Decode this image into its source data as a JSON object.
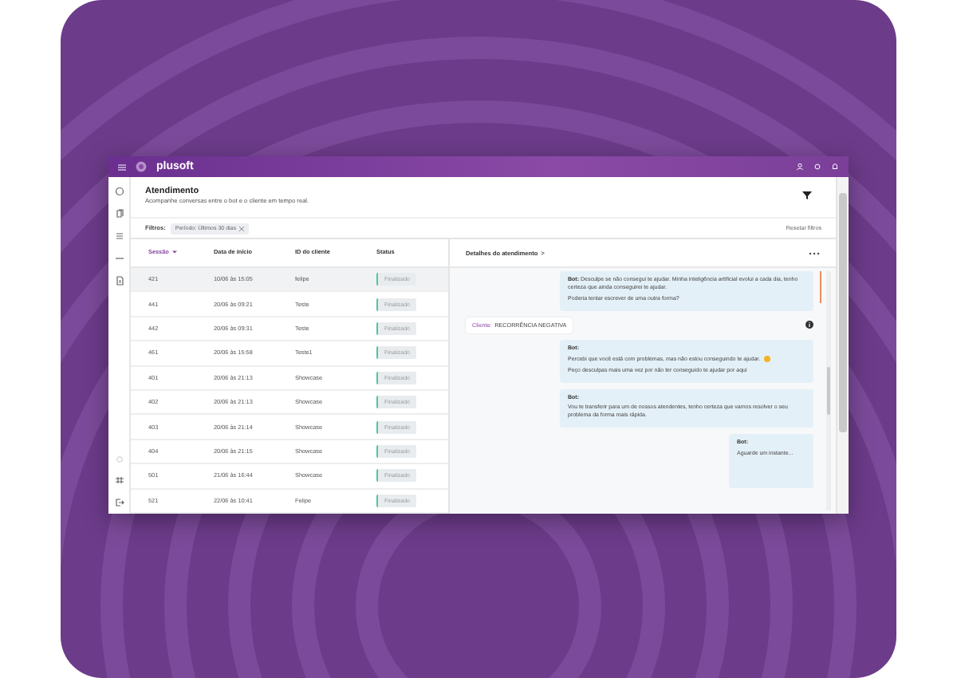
{
  "topbar": {
    "logo": "plusoft"
  },
  "page": {
    "title": "Atendimento",
    "subtitle": "Acompanhe conversas entre o bot e o cliente em tempo real."
  },
  "filters": {
    "label": "Filtros:",
    "chips": [
      {
        "text": "Período: Últimos 30 dias"
      }
    ],
    "reset": "Resetar filtros"
  },
  "table": {
    "columns": [
      {
        "label": "Sessão",
        "sorted": true
      },
      {
        "label": "Data de início",
        "sorted": false
      },
      {
        "label": "ID do cliente",
        "sorted": false
      },
      {
        "label": "Status",
        "sorted": false
      }
    ],
    "rows": [
      {
        "cells": [
          "421",
          "10/06 às 15:05",
          "felipe"
        ],
        "status": "Finalizado",
        "selected": true
      },
      {
        "cells": [
          "441",
          "20/06 às 09:21",
          "Teste"
        ],
        "status": "Finalizado",
        "selected": false
      },
      {
        "cells": [
          "442",
          "20/06 às 09:31",
          "Teste"
        ],
        "status": "Finalizado",
        "selected": false
      },
      {
        "cells": [
          "461",
          "20/06 às 15:58",
          "Teste1"
        ],
        "status": "Finalizado",
        "selected": false
      },
      {
        "cells": [
          "401",
          "20/06 às 21:13",
          "Showcase"
        ],
        "status": "Finalizado",
        "selected": false
      },
      {
        "cells": [
          "402",
          "20/06 às 21:13",
          "Showcase"
        ],
        "status": "Finalizado",
        "selected": false
      },
      {
        "cells": [
          "403",
          "20/06 às 21:14",
          "Showcase"
        ],
        "status": "Finalizado",
        "selected": false
      },
      {
        "cells": [
          "404",
          "20/06 às 21:15",
          "Showcase"
        ],
        "status": "Finalizado",
        "selected": false
      },
      {
        "cells": [
          "501",
          "21/06 às 16:44",
          "Showcase"
        ],
        "status": "Finalizado",
        "selected": false
      },
      {
        "cells": [
          "521",
          "22/06 às 10:41",
          "Felipe"
        ],
        "status": "Finalizado",
        "selected": false
      }
    ]
  },
  "details": {
    "title": "Detalhes do atendimento",
    "arrow": ">",
    "messages": [
      {
        "kind": "bot",
        "inline": true,
        "flagged": true,
        "sender": "Bot:",
        "paragraphs": [
          "Desculpe se não consegui te ajudar. Minha inteligência artificial evolui a cada dia, tenho certeza que ainda conseguirei te ajudar.",
          "Poderia tentar escrever de uma outra forma?"
        ],
        "narrow": false
      },
      {
        "kind": "client",
        "label": "Cliente:",
        "value": "RECORRÊNCIA NEGATIVA"
      },
      {
        "kind": "bot",
        "inline": false,
        "flagged": false,
        "emoji": true,
        "sender": "Bot:",
        "paragraphs": [
          "Percebi que você está com problemas, mas não estou conseguindo te ajudar.",
          "Peço desculpas mais uma vez por não ter conseguido te ajudar por aqui"
        ],
        "narrow": false
      },
      {
        "kind": "bot",
        "inline": false,
        "flagged": false,
        "sender": "Bot:",
        "paragraphs": [
          "Vou te transferir para um de nossos atendentes, tenho certeza que vamos resolver o seu problema da forma mais rápida."
        ],
        "narrow": false
      },
      {
        "kind": "bot",
        "inline": false,
        "flagged": false,
        "sender": "Bot:",
        "paragraphs": [
          "Aguarde um instante..."
        ],
        "narrow": true
      }
    ]
  }
}
